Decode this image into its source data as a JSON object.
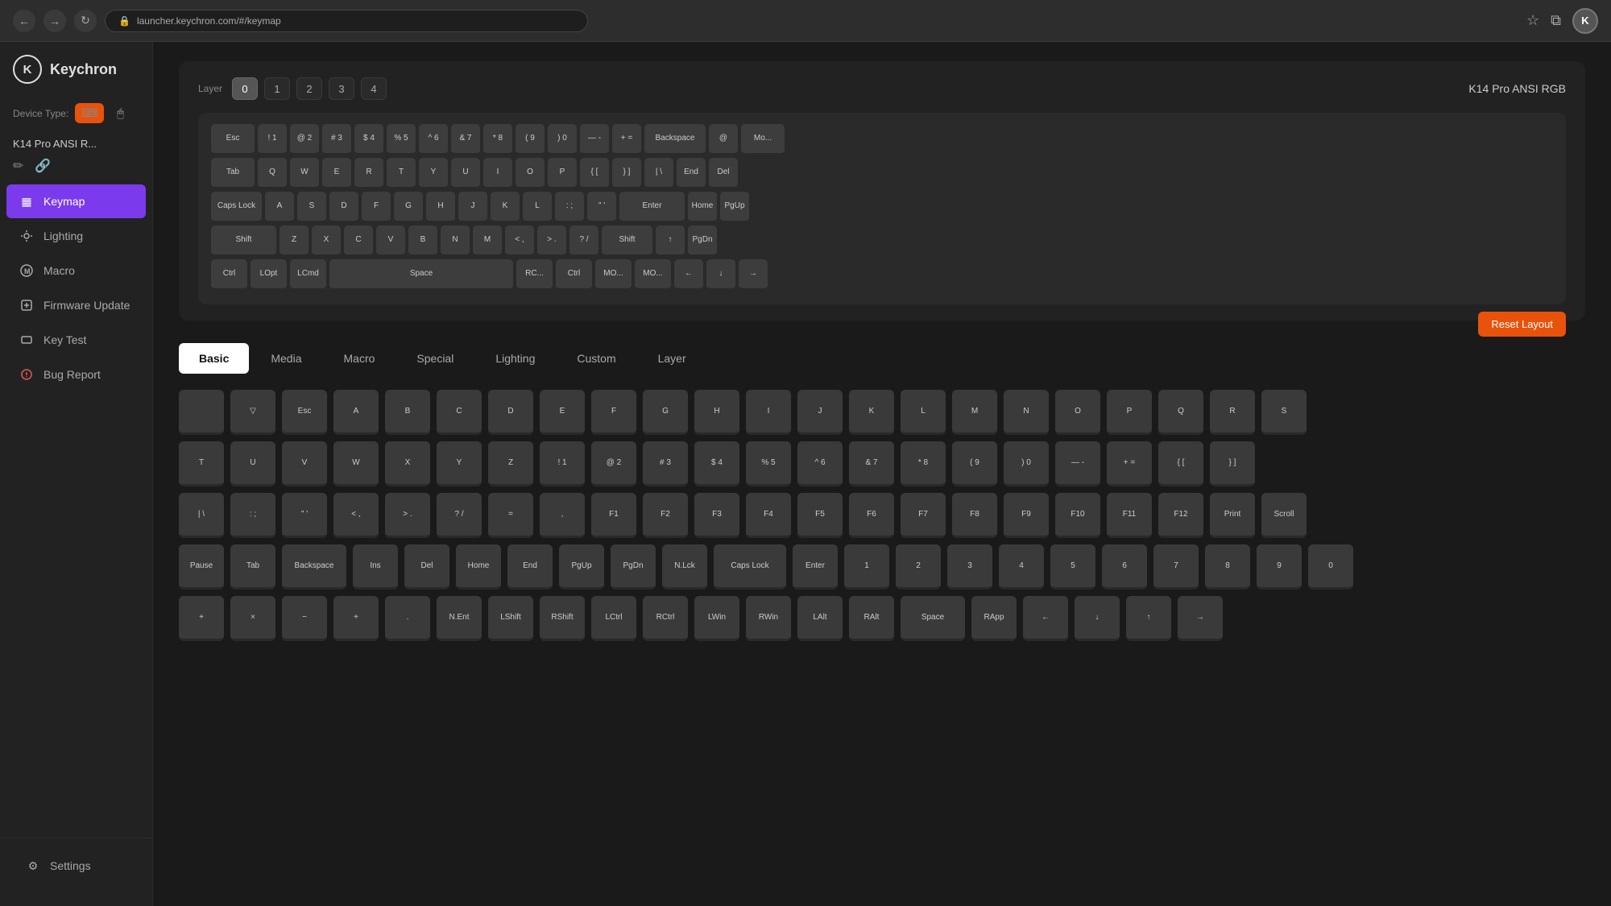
{
  "browser": {
    "url": "launcher.keychron.com/#/keymap",
    "back_icon": "←",
    "forward_icon": "→",
    "refresh_icon": "↻",
    "star_icon": "☆",
    "extensions_icon": "⧉",
    "avatar_text": "K"
  },
  "sidebar": {
    "logo_text": "Keychron",
    "logo_icon": "K",
    "device_type_label": "Device Type:",
    "device_name": "K14 Pro ANSI R...",
    "nav_items": [
      {
        "id": "keymap",
        "label": "Keymap",
        "icon": "▦",
        "active": true
      },
      {
        "id": "lighting",
        "label": "Lighting",
        "icon": "○"
      },
      {
        "id": "macro",
        "label": "Macro",
        "icon": "M"
      },
      {
        "id": "firmware",
        "label": "Firmware Update",
        "icon": "⬡"
      },
      {
        "id": "keytest",
        "label": "Key Test",
        "icon": "⬡"
      },
      {
        "id": "bugreport",
        "label": "Bug Report",
        "icon": "⬡"
      }
    ],
    "settings_label": "Settings",
    "settings_icon": "⚙"
  },
  "keyboard": {
    "layer_label": "Layer",
    "layers": [
      "0",
      "1",
      "2",
      "3",
      "4"
    ],
    "active_layer": "0",
    "title": "K14 Pro ANSI RGB",
    "reset_button": "Reset Layout",
    "rows": [
      [
        "Esc",
        "! 1",
        "@ 2",
        "# 3",
        "$ 4",
        "% 5",
        "^ 6",
        "& 7",
        "* 8",
        "( 9",
        ") 0",
        "— -",
        "+ =",
        "Backspace",
        "@",
        "Mo..."
      ],
      [
        "Tab",
        "Q",
        "W",
        "E",
        "R",
        "T",
        "Y",
        "U",
        "I",
        "O",
        "P",
        "{ [",
        "} ]",
        "| \\",
        "End",
        "Del"
      ],
      [
        "Caps Lock",
        "A",
        "S",
        "D",
        "F",
        "G",
        "H",
        "J",
        "K",
        "L",
        ": ;",
        "\" '",
        "Enter",
        "Home",
        "PgUp"
      ],
      [
        "Shift",
        "Z",
        "X",
        "C",
        "V",
        "B",
        "N",
        "M",
        "< ,",
        "> .",
        "? /",
        "Shift",
        "↑",
        "PgDn"
      ],
      [
        "Ctrl",
        "LOpt",
        "LCmd",
        "Space",
        "RC...",
        "Ctrl",
        "MO...",
        "MO...",
        "←",
        "↓",
        "→"
      ]
    ]
  },
  "keycode_panel": {
    "tabs": [
      {
        "id": "basic",
        "label": "Basic",
        "active": true
      },
      {
        "id": "media",
        "label": "Media"
      },
      {
        "id": "macro",
        "label": "Macro"
      },
      {
        "id": "special",
        "label": "Special"
      },
      {
        "id": "lighting",
        "label": "Lighting"
      },
      {
        "id": "custom",
        "label": "Custom"
      },
      {
        "id": "layer",
        "label": "Layer"
      }
    ],
    "rows": [
      [
        "",
        "▽",
        "Esc",
        "A",
        "B",
        "C",
        "D",
        "E",
        "F",
        "G",
        "H",
        "I",
        "J",
        "K",
        "L",
        "M",
        "N",
        "O",
        "P",
        "Q",
        "R",
        "S"
      ],
      [
        "T",
        "U",
        "V",
        "W",
        "X",
        "Y",
        "Z",
        "! 1",
        "@ 2",
        "# 3",
        "$ 4",
        "% 5",
        "^ 6",
        "& 7",
        "* 8",
        "( 9",
        ") 0",
        "— -",
        "+ =",
        "{ [",
        "} ]"
      ],
      [
        "| \\",
        ": ;",
        "\" '",
        "< ,",
        "> .",
        "? /",
        "=",
        ",",
        "F1",
        "F2",
        "F3",
        "F4",
        "F5",
        "F6",
        "F7",
        "F8",
        "F9",
        "F10",
        "F11",
        "F12",
        "Print",
        "Scroll"
      ],
      [
        "Pause",
        "Tab",
        "Backspace",
        "Ins",
        "Del",
        "Home",
        "End",
        "PgUp",
        "PgDn",
        "N.Lck",
        "Caps Lock",
        "Enter",
        "1",
        "2",
        "3",
        "4",
        "5",
        "6",
        "7",
        "8",
        "9",
        "0"
      ],
      [
        "+",
        "×",
        "−",
        "+",
        ".",
        "N.Ent",
        "LShift",
        "RShift",
        "LCtrl",
        "RCtrl",
        "LWin",
        "RWin",
        "LAlt",
        "RAlt",
        "Space",
        "RApp",
        "←",
        "↓",
        "↑",
        "→"
      ]
    ]
  }
}
